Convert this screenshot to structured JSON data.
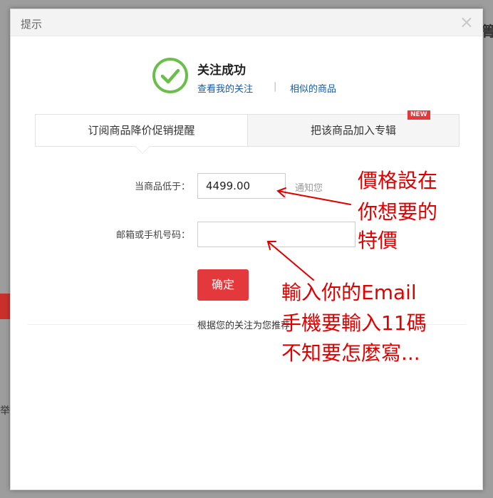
{
  "dialog": {
    "title": "提示",
    "close_symbol": "×"
  },
  "success": {
    "icon": "check-circle-icon",
    "title": "关注成功",
    "link_my_follows": "查看我的关注",
    "separator": "|",
    "link_similar": "相似的商品"
  },
  "tabs": [
    {
      "label": "订阅商品降价促销提醒"
    },
    {
      "label": "把该商品加入专辑",
      "badge": "NEW"
    }
  ],
  "form": {
    "price_label": "当商品低于：",
    "price_value": "4499.00",
    "notify_text": "通知您",
    "email_label": "邮箱或手机号码：",
    "email_value": "",
    "confirm_label": "确定"
  },
  "recommend": {
    "text": "根据您的关注为您推荐"
  },
  "annotations": {
    "price_note": [
      "價格設在",
      "你想要的",
      "特價"
    ],
    "email_note": [
      "輸入你的Email",
      "手機要輸入11碼",
      "不知要怎麼寫..."
    ]
  },
  "background": {
    "char_top_right": "箐",
    "char_left": "举"
  },
  "colors": {
    "accent_red": "#e4393c",
    "link_blue": "#1a5aa0",
    "success_green": "#6abf4b",
    "annotation_red": "#e00000"
  }
}
